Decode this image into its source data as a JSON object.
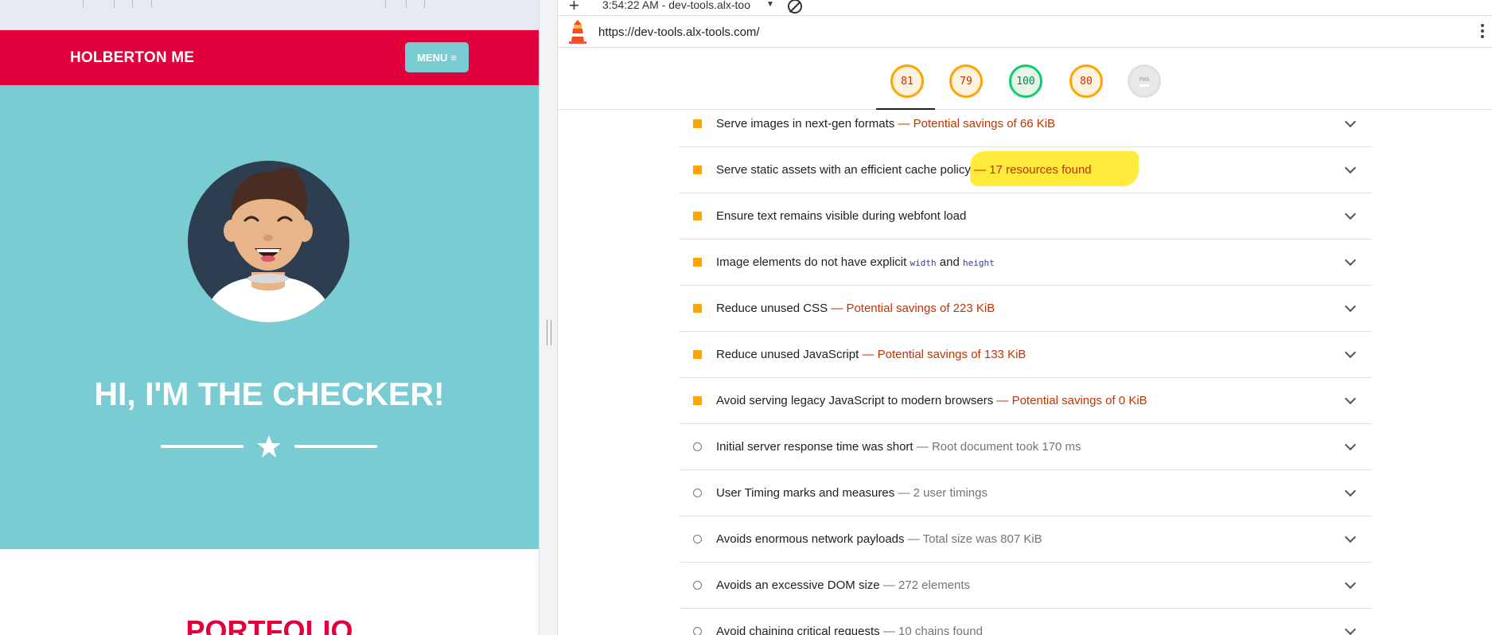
{
  "site": {
    "brand": "HOLBERTON ME",
    "menu_label": "MENU",
    "hero_title": "HI, I'M THE CHECKER!",
    "portfolio_title": "PORTFOLIO"
  },
  "devtools": {
    "timestamp": "3:54:22 AM - dev-tools.alx-too",
    "url": "https://dev-tools.alx-tools.com/",
    "scores": [
      {
        "value": "81",
        "status": "orange"
      },
      {
        "value": "79",
        "status": "orange"
      },
      {
        "value": "100",
        "status": "green"
      },
      {
        "value": "80",
        "status": "orange"
      },
      {
        "value": "PWA",
        "status": "gray"
      }
    ],
    "audits": [
      {
        "title": "Serve images in next-gen formats",
        "separator": "—",
        "detail": "Potential savings of 66 KiB",
        "kind": "warn"
      },
      {
        "title": "Serve static assets with an efficient cache policy",
        "separator": "—",
        "detail": "17 resources found",
        "kind": "warn"
      },
      {
        "title": "Ensure text remains visible during webfont load",
        "separator": "",
        "detail": "",
        "kind": "warn"
      },
      {
        "title": "Image elements do not have explicit",
        "code1": "width",
        "and": "and",
        "code2": "height",
        "kind": "warn"
      },
      {
        "title": "Reduce unused CSS",
        "separator": "—",
        "detail": "Potential savings of 223 KiB",
        "kind": "warn"
      },
      {
        "title": "Reduce unused JavaScript",
        "separator": "—",
        "detail": "Potential savings of 133 KiB",
        "kind": "warn"
      },
      {
        "title": "Avoid serving legacy JavaScript to modern browsers",
        "separator": "—",
        "detail": "Potential savings of 0 KiB",
        "kind": "warn"
      },
      {
        "title": "Initial server response time was short",
        "separator": "—",
        "detail": "Root document took 170 ms",
        "kind": "pass"
      },
      {
        "title": "User Timing marks and measures",
        "separator": "—",
        "detail": "2 user timings",
        "kind": "pass"
      },
      {
        "title": "Avoids enormous network payloads",
        "separator": "—",
        "detail": "Total size was 807 KiB",
        "kind": "pass"
      },
      {
        "title": "Avoids an excessive DOM size",
        "separator": "—",
        "detail": "272 elements",
        "kind": "pass"
      },
      {
        "title": "Avoid chaining critical requests",
        "separator": "—",
        "detail": "10 chains found",
        "kind": "pass"
      }
    ]
  },
  "colors": {
    "brand_red": "#e2003c",
    "teal": "#79cdd2",
    "score_orange": "#ffa400",
    "score_green": "#0cce6b",
    "warn_text": "#c33300",
    "highlight": "#ffeb3b"
  }
}
